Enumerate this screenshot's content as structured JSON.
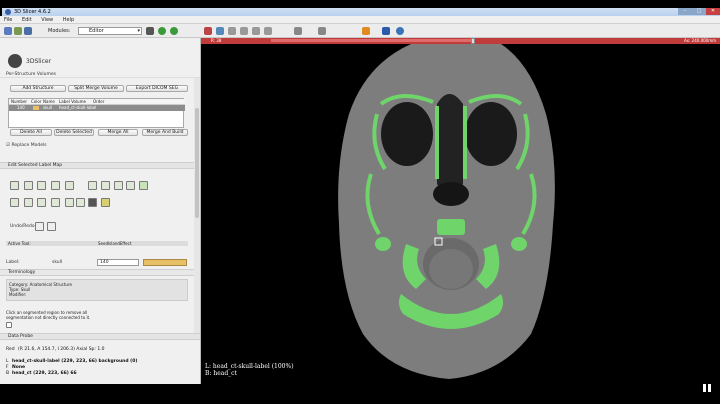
{
  "window": {
    "title": "3D Slicer 4.6.2",
    "controls": [
      "–",
      "□",
      "✕"
    ]
  },
  "menu": [
    "File",
    "Edit",
    "View",
    "Help"
  ],
  "toolbar": {
    "modules_label": "Modules:",
    "module_selected": "Editor",
    "icons": [
      "data-icon",
      "dcm-icon",
      "save-icon",
      "back-icon",
      "forward-icon",
      "module-search-icon",
      "layout-icon",
      "view-icon",
      "crosshair-icon",
      "mouse-icon",
      "pin-icon",
      "extension-icon",
      "python-icon"
    ]
  },
  "panel": {
    "app_name": "3DSlicer",
    "per_structure_title": "Per-Structure Volumes",
    "buttons_row1": [
      "Add Structure",
      "Split Merge Volume",
      "Export DICOM SEG"
    ],
    "table": {
      "columns": [
        "Number",
        "Color",
        "Name",
        "Label Volume",
        "Order"
      ],
      "row": {
        "number": "140",
        "name": "skull",
        "label_volume": "head_ct-skull-label"
      }
    },
    "buttons_row2": [
      "Delete All",
      "Delete Selected",
      "Merge All",
      "Merge And Build"
    ],
    "replace_models": "Replace Models",
    "edit_section": "Edit Selected Label Map",
    "undo_redo": "Undo/Redo:",
    "active_tool_label": "Active Tool:",
    "active_tool_value": "SeedIslandEffect",
    "label_label": "Label:",
    "label_name": "skull",
    "label_value": "140",
    "terminology_title": "Terminology",
    "terminology": {
      "category": "Category: Anatomical Structure",
      "type": "Type: Skull",
      "modifier": "Modifier:"
    },
    "hint_line1": "Click an segmented region to remove all",
    "hint_line2": "segmentation not directly connected to it.",
    "data_probe_title": "Data Probe",
    "probe_rows": [
      {
        "label": "Red",
        "value": "(R 21.6, A 154.7, I 206.3)   Axial Sp: 1.0"
      },
      {
        "label": "L",
        "value": "head_ct-skull-label   (229, 223, 66) background (0)"
      },
      {
        "label": "F",
        "value": "None"
      },
      {
        "label": "B",
        "value": "head_ct   (229, 223, 66) 66"
      }
    ]
  },
  "view": {
    "slice_offset": "R: 38",
    "slice_right": "Ax: 240.000mm",
    "overlay_line1": "L: head_ct-skull-label (100%)",
    "overlay_line2": "B: head_ct"
  },
  "colors": {
    "accent_red": "#c23b3b",
    "segmentation_green": "#6fd46a",
    "label_color": "#e8c068"
  }
}
